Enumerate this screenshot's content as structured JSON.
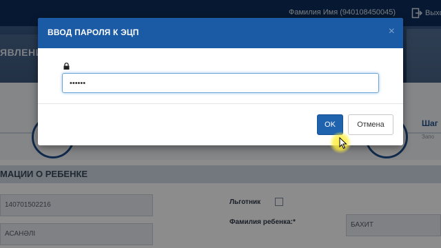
{
  "header": {
    "user_label": "Фамилия Имя (940108450045)",
    "logout_label": "Выход"
  },
  "hero": {
    "title": "ЯВЛЕНИЕ"
  },
  "steps": {
    "step_label": "Шаг",
    "step_sub": "Запо"
  },
  "section": {
    "title": "МАЦИИ О РЕБЕНКЕ"
  },
  "form": {
    "iin_value": "140701502216",
    "surname_value": "АСАНӘЛІ",
    "benefit_label": "Льготник",
    "child_surname_label": "Фамилия ребенка:*",
    "child_surname_value": "БАХИТ"
  },
  "modal": {
    "title": "ВВОД ПАРОЛЯ К ЭЦП",
    "close_glyph": "×",
    "password_value": "••••••",
    "ok_label": "OK",
    "cancel_label": "Отмена"
  },
  "colors": {
    "modal_header": "#1b5aa4",
    "ok_button": "#1f62ad",
    "topbar": "#0d2f5c",
    "cursor_highlight": "#ffec3c"
  }
}
